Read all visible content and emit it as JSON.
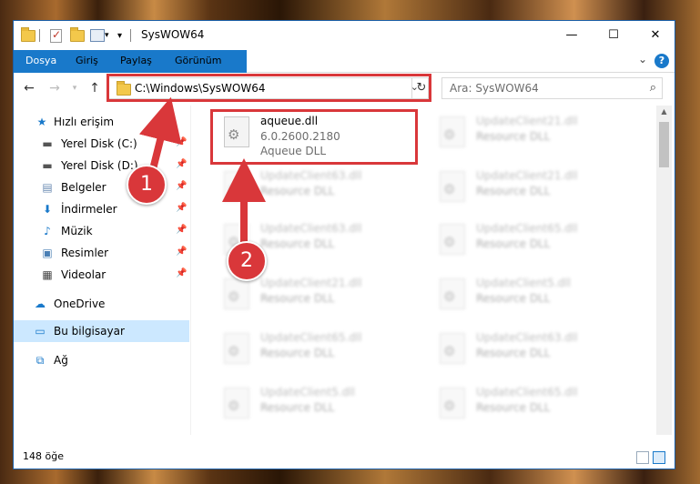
{
  "window": {
    "title": "SysWOW64",
    "controls": {
      "minimize": "—",
      "maximize": "☐",
      "close": "✕"
    }
  },
  "ribbon": {
    "tabs": [
      "Dosya",
      "Giriş",
      "Paylaş",
      "Görünüm"
    ],
    "help_label": "?"
  },
  "address": {
    "path": "C:\\Windows\\SysWOW64",
    "search_placeholder": "Ara: SysWOW64"
  },
  "sidebar": {
    "items": [
      {
        "label": "Hızlı erişim",
        "icon": "star-icon",
        "pinned": false
      },
      {
        "label": "Yerel Disk (C:)",
        "icon": "drive-icon",
        "pinned": true
      },
      {
        "label": "Yerel Disk (D:)",
        "icon": "drive-icon",
        "pinned": true
      },
      {
        "label": "Belgeler",
        "icon": "documents-icon",
        "pinned": true
      },
      {
        "label": "İndirmeler",
        "icon": "download-icon",
        "pinned": true
      },
      {
        "label": "Müzik",
        "icon": "music-icon",
        "pinned": true
      },
      {
        "label": "Resimler",
        "icon": "pictures-icon",
        "pinned": true
      },
      {
        "label": "Videolar",
        "icon": "video-icon",
        "pinned": true
      },
      {
        "label": "OneDrive",
        "icon": "cloud-icon",
        "pinned": false
      },
      {
        "label": "Bu bilgisayar",
        "icon": "computer-icon",
        "pinned": false
      },
      {
        "label": "Ağ",
        "icon": "network-icon",
        "pinned": false
      }
    ]
  },
  "files": [
    {
      "name": "aqueue.dll",
      "version": "6.0.2600.2180",
      "description": "Aqueue DLL"
    },
    {
      "name": "UpdateClient21.dll",
      "description": "Resource DLL"
    },
    {
      "name": "UpdateClient63.dll",
      "description": "Resource DLL"
    },
    {
      "name": "UpdateClient21.dll",
      "description": "Resource DLL"
    },
    {
      "name": "UpdateClient63.dll",
      "description": "Resource DLL"
    },
    {
      "name": "UpdateClient65.dll",
      "description": "Resource DLL"
    },
    {
      "name": "UpdateClient21.dll",
      "description": "Resource DLL"
    },
    {
      "name": "UpdateClient5.dll",
      "description": "Resource DLL"
    },
    {
      "name": "UpdateClient65.dll",
      "description": "Resource DLL"
    },
    {
      "name": "UpdateClient63.dll",
      "description": "Resource DLL"
    },
    {
      "name": "UpdateClient5.dll",
      "description": "Resource DLL"
    },
    {
      "name": "UpdateClient65.dll",
      "description": "Resource DLL"
    }
  ],
  "status": {
    "item_count": "148 öğe"
  },
  "callouts": [
    "1",
    "2"
  ],
  "colors": {
    "accent": "#1979ca",
    "highlight": "#d9373a",
    "selected_bg": "#cce8ff"
  }
}
